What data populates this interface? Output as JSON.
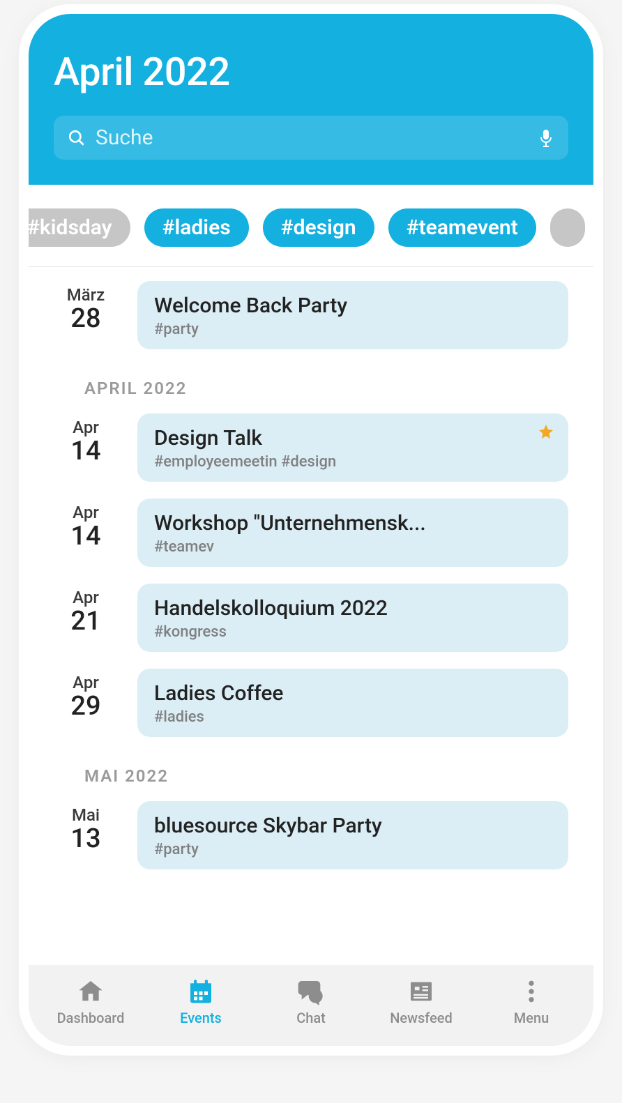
{
  "header": {
    "title": "April 2022",
    "search_placeholder": "Suche"
  },
  "chips": [
    {
      "label": "#kidsday",
      "state": "inactive"
    },
    {
      "label": "#ladies",
      "state": "active"
    },
    {
      "label": "#design",
      "state": "active"
    },
    {
      "label": "#teamevent",
      "state": "active"
    }
  ],
  "sections": [
    {
      "label": null,
      "events": [
        {
          "month": "März",
          "day": "28",
          "title": "Welcome Back Party",
          "tags": "#party",
          "starred": false
        }
      ]
    },
    {
      "label": "APRIL 2022",
      "events": [
        {
          "month": "Apr",
          "day": "14",
          "title": "Design Talk",
          "tags": "#employeemeetin #design",
          "starred": true
        },
        {
          "month": "Apr",
          "day": "14",
          "title": "Workshop \"Unternehmensk...",
          "tags": "#teamev",
          "starred": false
        },
        {
          "month": "Apr",
          "day": "21",
          "title": "Handelskolloquium 2022",
          "tags": "#kongress",
          "starred": false
        },
        {
          "month": "Apr",
          "day": "29",
          "title": "Ladies Coffee",
          "tags": "#ladies",
          "starred": false
        }
      ]
    },
    {
      "label": "MAI 2022",
      "events": [
        {
          "month": "Mai",
          "day": "13",
          "title": "bluesource Skybar Party",
          "tags": "#party",
          "starred": false
        }
      ]
    }
  ],
  "tabs": [
    {
      "id": "dashboard",
      "label": "Dashboard",
      "active": false
    },
    {
      "id": "events",
      "label": "Events",
      "active": true
    },
    {
      "id": "chat",
      "label": "Chat",
      "active": false
    },
    {
      "id": "newsfeed",
      "label": "Newsfeed",
      "active": false
    },
    {
      "id": "menu",
      "label": "Menu",
      "active": false
    }
  ],
  "colors": {
    "accent": "#13b0e0",
    "card": "#dbeef6",
    "chip_inactive": "#c6c6c6",
    "star": "#f5a623"
  }
}
